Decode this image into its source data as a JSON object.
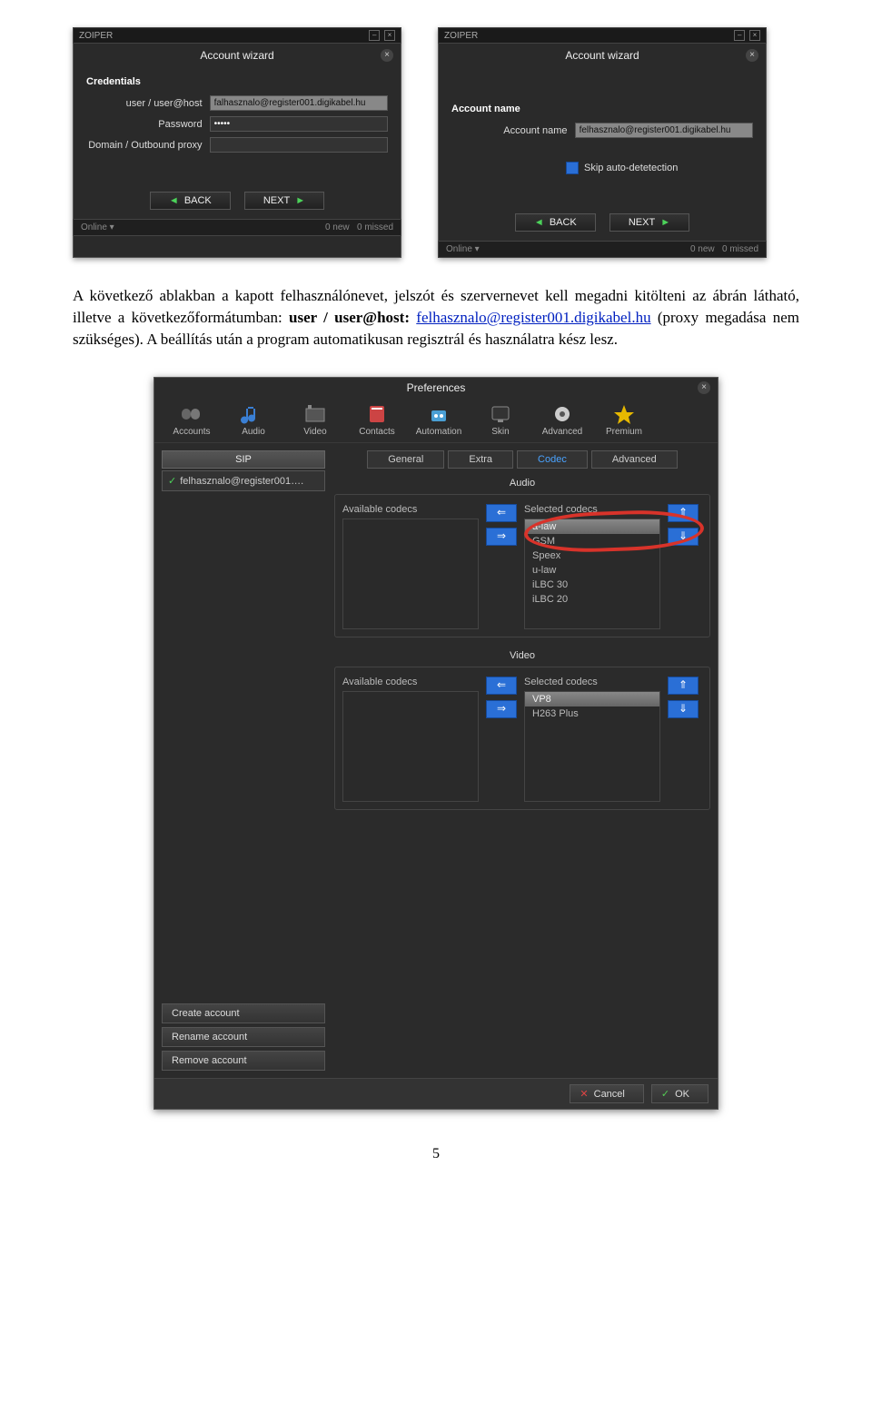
{
  "wizard_left": {
    "app_name": "ZOIPER",
    "title": "Account wizard",
    "section": "Credentials",
    "labels": {
      "user": "user / user@host",
      "password": "Password",
      "domain": "Domain / Outbound proxy"
    },
    "fields": {
      "user_value": "falhasznalo@register001.digikabel.hu",
      "password_value": "•••••",
      "domain_value": ""
    },
    "buttons": {
      "back": "BACK",
      "next": "NEXT"
    },
    "status": {
      "left": "Online ▾",
      "mid": "0 new",
      "right": "0 missed"
    }
  },
  "wizard_right": {
    "app_name": "ZOIPER",
    "title": "Account wizard",
    "section": "Account name",
    "labels": {
      "account_name": "Account name",
      "skip": "Skip auto-detetection"
    },
    "fields": {
      "account_name_value": "felhasznalo@register001.digikabel.hu"
    },
    "buttons": {
      "back": "BACK",
      "next": "NEXT"
    },
    "status": {
      "left": "Online ▾",
      "mid": "0 new",
      "right": "0 missed"
    }
  },
  "doc": {
    "para_1": "A következő ablakban a kapott felhasználónevet, jelszót és szervernevet kell megadni kitölteni az ábrán látható, illetve a következőformátumban: ",
    "bold_1": "user / user@host: ",
    "link_text": "felhasznalo@register001.digikabel.hu",
    "para_2": " (proxy megadása nem szükséges). A beállítás után a program automatikusan regisztrál és használatra kész lesz."
  },
  "prefs": {
    "title": "Preferences",
    "toolbar": [
      "Accounts",
      "Audio",
      "Video",
      "Contacts",
      "Automation",
      "Skin",
      "Advanced",
      "Premium"
    ],
    "sidebar": {
      "header": "SIP",
      "account": "felhasznalo@register001….",
      "buttons": [
        "Create account",
        "Rename account",
        "Remove account"
      ]
    },
    "tabs": [
      "General",
      "Extra",
      "Codec",
      "Advanced"
    ],
    "active_tab": "Codec",
    "audio": {
      "heading": "Audio",
      "available_label": "Available codecs",
      "selected_label": "Selected codecs",
      "available": [],
      "selected": [
        "a-law",
        "GSM",
        "Speex",
        "u-law",
        "iLBC 30",
        "iLBC 20"
      ]
    },
    "video": {
      "heading": "Video",
      "available_label": "Available codecs",
      "selected_label": "Selected codecs",
      "available": [],
      "selected": [
        "VP8",
        "H263 Plus"
      ]
    },
    "bottom": {
      "cancel": "Cancel",
      "ok": "OK"
    }
  },
  "page_number": "5"
}
